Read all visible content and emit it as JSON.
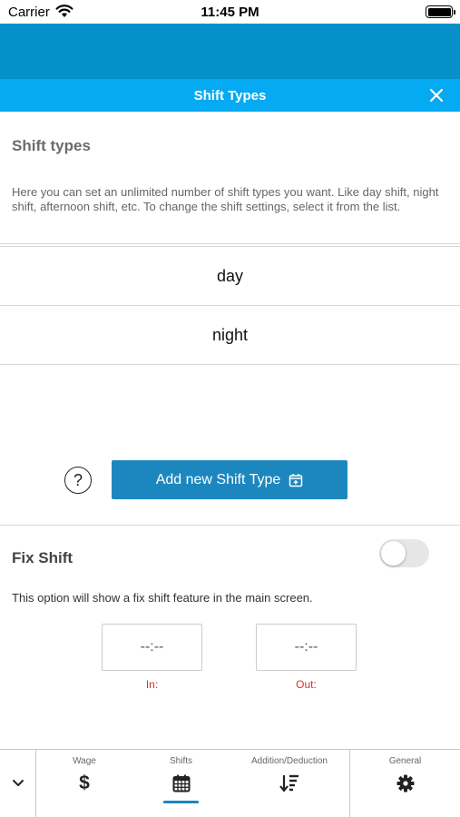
{
  "status_bar": {
    "carrier": "Carrier",
    "time": "11:45 PM"
  },
  "title_bar": {
    "title": "Shift Types"
  },
  "section": {
    "title": "Shift types",
    "description": "Here you can set an unlimited number of shift types you want. Like day shift, night shift, afternoon shift, etc. To change the shift settings, select it from the list."
  },
  "shift_types": [
    {
      "name": "day"
    },
    {
      "name": "night"
    }
  ],
  "actions": {
    "help_symbol": "?",
    "add_label": "Add new Shift Type"
  },
  "fix_shift": {
    "title": "Fix Shift",
    "enabled": false,
    "description": "This option will show a fix shift feature in the main screen.",
    "in_value": "--:--",
    "in_label": "In:",
    "out_value": "--:--",
    "out_label": "Out:"
  },
  "tabs": [
    {
      "label": "Wage",
      "icon": "dollar-icon",
      "glyph": "$",
      "active": false
    },
    {
      "label": "Shifts",
      "icon": "calendar-icon",
      "active": true
    },
    {
      "label": "Addition/Deduction",
      "icon": "sort-icon",
      "active": false
    },
    {
      "label": "General",
      "icon": "gear-icon",
      "active": false
    }
  ],
  "colors": {
    "header": "#0590c9",
    "title_bar": "#05aaf2",
    "button": "#1c87be",
    "time_label": "#e0301e"
  }
}
